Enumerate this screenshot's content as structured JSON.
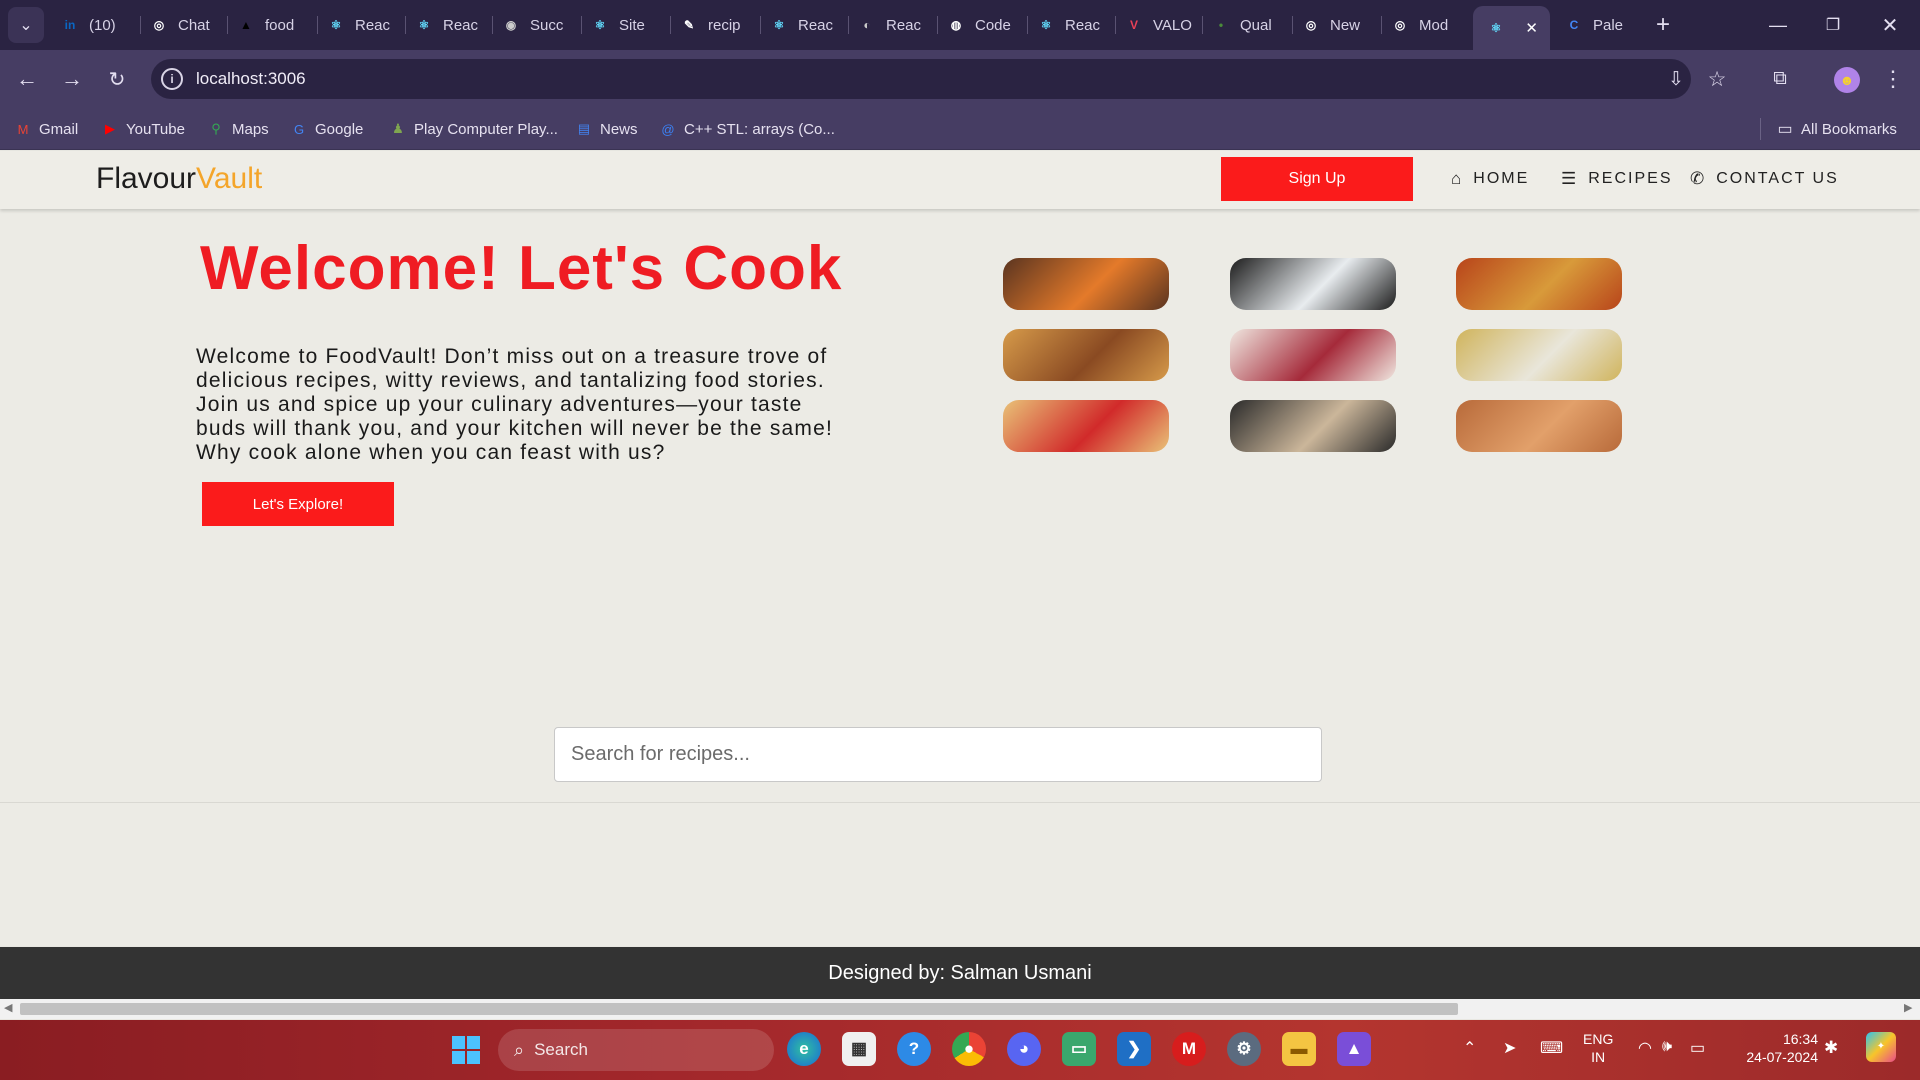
{
  "browser": {
    "tabs": [
      {
        "label": "(10)",
        "icon": "linkedin-icon",
        "color": "#0a66c2",
        "glyph": "in"
      },
      {
        "label": "Chat",
        "icon": "chatgpt-icon",
        "color": "#ffffff",
        "glyph": "◎"
      },
      {
        "label": "food",
        "icon": "vercel-icon",
        "color": "#000000",
        "glyph": "▲"
      },
      {
        "label": "Reac",
        "icon": "react-icon",
        "color": "#61dafb",
        "glyph": "⚛"
      },
      {
        "label": "Reac",
        "icon": "react-icon",
        "color": "#61dafb",
        "glyph": "⚛"
      },
      {
        "label": "Succ",
        "icon": "succ-icon",
        "color": "#cccccc",
        "glyph": "◉"
      },
      {
        "label": "Site",
        "icon": "react-icon",
        "color": "#61dafb",
        "glyph": "⚛"
      },
      {
        "label": "recip",
        "icon": "recipe-icon",
        "color": "#ffffff",
        "glyph": "✎"
      },
      {
        "label": "Reac",
        "icon": "react-icon",
        "color": "#61dafb",
        "glyph": "⚛"
      },
      {
        "label": "Reac",
        "icon": "globe-icon",
        "color": "#cccccc",
        "glyph": "◐"
      },
      {
        "label": "Code",
        "icon": "github-icon",
        "color": "#ffffff",
        "glyph": "◍"
      },
      {
        "label": "Reac",
        "icon": "react-icon",
        "color": "#61dafb",
        "glyph": "⚛"
      },
      {
        "label": "VALO",
        "icon": "valorant-icon",
        "color": "#e84057",
        "glyph": "V"
      },
      {
        "label": "Qual",
        "icon": "qual-icon",
        "color": "#4a8a3a",
        "glyph": "•"
      },
      {
        "label": "New",
        "icon": "chrome-icon",
        "color": "#ffffff",
        "glyph": "◎"
      },
      {
        "label": "Mod",
        "icon": "chatgpt-icon",
        "color": "#ffffff",
        "glyph": "◎"
      },
      {
        "label": "",
        "icon": "react-icon",
        "color": "#61dafb",
        "glyph": "⚛"
      },
      {
        "label": "Pale",
        "icon": "palette-icon",
        "color": "#4285f4",
        "glyph": "C"
      }
    ],
    "address": "localhost:3006",
    "bookmarks": [
      {
        "label": "Gmail",
        "icon": "gmail-icon",
        "color": "#ea4335",
        "glyph": "M"
      },
      {
        "label": "YouTube",
        "icon": "youtube-icon",
        "color": "#ff0000",
        "glyph": "▶"
      },
      {
        "label": "Maps",
        "icon": "maps-icon",
        "color": "#34a853",
        "glyph": "⚲"
      },
      {
        "label": "Google",
        "icon": "google-icon",
        "color": "#4285f4",
        "glyph": "G"
      },
      {
        "label": "Play Computer Play...",
        "icon": "chess-icon",
        "color": "#7fa650",
        "glyph": "♟"
      },
      {
        "label": "News",
        "icon": "news-icon",
        "color": "#4285f4",
        "glyph": "▤"
      },
      {
        "label": "C++ STL: arrays (Co...",
        "icon": "at-icon",
        "color": "#3b82f6",
        "glyph": "@"
      }
    ],
    "all_bookmarks": "All Bookmarks"
  },
  "site": {
    "logo_part1": "Flavour",
    "logo_part2": "Vault",
    "signup": "Sign Up",
    "nav": [
      {
        "label": "HOME",
        "icon": "home-icon"
      },
      {
        "label": "RECIPES",
        "icon": "list-icon"
      },
      {
        "label": "CONTACT US",
        "icon": "phone-icon"
      }
    ],
    "hero_title": "Welcome! Let's Cook",
    "hero_text": "Welcome to FoodVault! Don’t miss out on a treasure trove of delicious recipes, witty reviews, and tantalizing food stories. Join us and spice up your culinary adventures—your taste buds will thank you, and your kitchen will never be the same! Why cook alone when you can feast with us?",
    "explore": "Let's Explore!",
    "search_placeholder": "Search for recipes...",
    "footer": "Designed by: Salman Usmani",
    "food_images": [
      {
        "name": "food-image-beef-sweet-potato",
        "c1": "#5a3420",
        "c2": "#e47a2a"
      },
      {
        "name": "food-image-cookie-milk",
        "c1": "#1c1c1c",
        "c2": "#e8ecef"
      },
      {
        "name": "food-image-chicken-wings",
        "c1": "#b8441a",
        "c2": "#d89a3a"
      },
      {
        "name": "food-image-crepe-roll",
        "c1": "#d69a4a",
        "c2": "#8a4a22"
      },
      {
        "name": "food-image-cobbler-icecream",
        "c1": "#f0e7e0",
        "c2": "#a52a3a"
      },
      {
        "name": "food-image-muffin",
        "c1": "#d0b45c",
        "c2": "#e9e6da"
      },
      {
        "name": "food-image-strawberry-cake",
        "c1": "#e9c278",
        "c2": "#d12a2a"
      },
      {
        "name": "food-image-oatmeal-bowl",
        "c1": "#2a2a2a",
        "c2": "#cbb69a"
      },
      {
        "name": "food-image-roasted-fish",
        "c1": "#b86a3a",
        "c2": "#e2a06a"
      }
    ]
  },
  "taskbar": {
    "search": "Search",
    "lang1": "ENG",
    "lang2": "IN",
    "time": "16:34",
    "date": "24-07-2024"
  }
}
